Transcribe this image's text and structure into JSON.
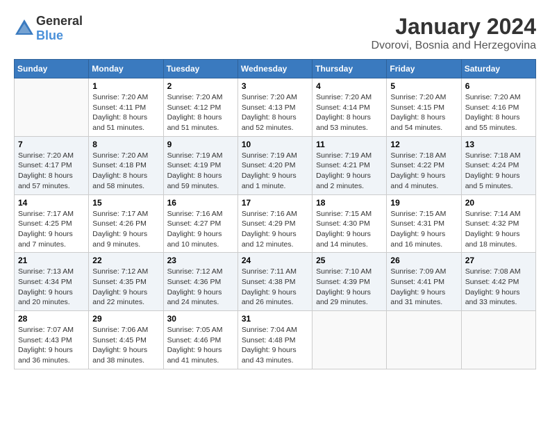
{
  "logo": {
    "general": "General",
    "blue": "Blue"
  },
  "header": {
    "month_year": "January 2024",
    "location": "Dvorovi, Bosnia and Herzegovina"
  },
  "days_of_week": [
    "Sunday",
    "Monday",
    "Tuesday",
    "Wednesday",
    "Thursday",
    "Friday",
    "Saturday"
  ],
  "weeks": [
    [
      {
        "day": "",
        "empty": true
      },
      {
        "day": "1",
        "sunrise": "Sunrise: 7:20 AM",
        "sunset": "Sunset: 4:11 PM",
        "daylight": "Daylight: 8 hours and 51 minutes."
      },
      {
        "day": "2",
        "sunrise": "Sunrise: 7:20 AM",
        "sunset": "Sunset: 4:12 PM",
        "daylight": "Daylight: 8 hours and 51 minutes."
      },
      {
        "day": "3",
        "sunrise": "Sunrise: 7:20 AM",
        "sunset": "Sunset: 4:13 PM",
        "daylight": "Daylight: 8 hours and 52 minutes."
      },
      {
        "day": "4",
        "sunrise": "Sunrise: 7:20 AM",
        "sunset": "Sunset: 4:14 PM",
        "daylight": "Daylight: 8 hours and 53 minutes."
      },
      {
        "day": "5",
        "sunrise": "Sunrise: 7:20 AM",
        "sunset": "Sunset: 4:15 PM",
        "daylight": "Daylight: 8 hours and 54 minutes."
      },
      {
        "day": "6",
        "sunrise": "Sunrise: 7:20 AM",
        "sunset": "Sunset: 4:16 PM",
        "daylight": "Daylight: 8 hours and 55 minutes."
      }
    ],
    [
      {
        "day": "7",
        "sunrise": "Sunrise: 7:20 AM",
        "sunset": "Sunset: 4:17 PM",
        "daylight": "Daylight: 8 hours and 57 minutes."
      },
      {
        "day": "8",
        "sunrise": "Sunrise: 7:20 AM",
        "sunset": "Sunset: 4:18 PM",
        "daylight": "Daylight: 8 hours and 58 minutes."
      },
      {
        "day": "9",
        "sunrise": "Sunrise: 7:19 AM",
        "sunset": "Sunset: 4:19 PM",
        "daylight": "Daylight: 8 hours and 59 minutes."
      },
      {
        "day": "10",
        "sunrise": "Sunrise: 7:19 AM",
        "sunset": "Sunset: 4:20 PM",
        "daylight": "Daylight: 9 hours and 1 minute."
      },
      {
        "day": "11",
        "sunrise": "Sunrise: 7:19 AM",
        "sunset": "Sunset: 4:21 PM",
        "daylight": "Daylight: 9 hours and 2 minutes."
      },
      {
        "day": "12",
        "sunrise": "Sunrise: 7:18 AM",
        "sunset": "Sunset: 4:22 PM",
        "daylight": "Daylight: 9 hours and 4 minutes."
      },
      {
        "day": "13",
        "sunrise": "Sunrise: 7:18 AM",
        "sunset": "Sunset: 4:24 PM",
        "daylight": "Daylight: 9 hours and 5 minutes."
      }
    ],
    [
      {
        "day": "14",
        "sunrise": "Sunrise: 7:17 AM",
        "sunset": "Sunset: 4:25 PM",
        "daylight": "Daylight: 9 hours and 7 minutes."
      },
      {
        "day": "15",
        "sunrise": "Sunrise: 7:17 AM",
        "sunset": "Sunset: 4:26 PM",
        "daylight": "Daylight: 9 hours and 9 minutes."
      },
      {
        "day": "16",
        "sunrise": "Sunrise: 7:16 AM",
        "sunset": "Sunset: 4:27 PM",
        "daylight": "Daylight: 9 hours and 10 minutes."
      },
      {
        "day": "17",
        "sunrise": "Sunrise: 7:16 AM",
        "sunset": "Sunset: 4:29 PM",
        "daylight": "Daylight: 9 hours and 12 minutes."
      },
      {
        "day": "18",
        "sunrise": "Sunrise: 7:15 AM",
        "sunset": "Sunset: 4:30 PM",
        "daylight": "Daylight: 9 hours and 14 minutes."
      },
      {
        "day": "19",
        "sunrise": "Sunrise: 7:15 AM",
        "sunset": "Sunset: 4:31 PM",
        "daylight": "Daylight: 9 hours and 16 minutes."
      },
      {
        "day": "20",
        "sunrise": "Sunrise: 7:14 AM",
        "sunset": "Sunset: 4:32 PM",
        "daylight": "Daylight: 9 hours and 18 minutes."
      }
    ],
    [
      {
        "day": "21",
        "sunrise": "Sunrise: 7:13 AM",
        "sunset": "Sunset: 4:34 PM",
        "daylight": "Daylight: 9 hours and 20 minutes."
      },
      {
        "day": "22",
        "sunrise": "Sunrise: 7:12 AM",
        "sunset": "Sunset: 4:35 PM",
        "daylight": "Daylight: 9 hours and 22 minutes."
      },
      {
        "day": "23",
        "sunrise": "Sunrise: 7:12 AM",
        "sunset": "Sunset: 4:36 PM",
        "daylight": "Daylight: 9 hours and 24 minutes."
      },
      {
        "day": "24",
        "sunrise": "Sunrise: 7:11 AM",
        "sunset": "Sunset: 4:38 PM",
        "daylight": "Daylight: 9 hours and 26 minutes."
      },
      {
        "day": "25",
        "sunrise": "Sunrise: 7:10 AM",
        "sunset": "Sunset: 4:39 PM",
        "daylight": "Daylight: 9 hours and 29 minutes."
      },
      {
        "day": "26",
        "sunrise": "Sunrise: 7:09 AM",
        "sunset": "Sunset: 4:41 PM",
        "daylight": "Daylight: 9 hours and 31 minutes."
      },
      {
        "day": "27",
        "sunrise": "Sunrise: 7:08 AM",
        "sunset": "Sunset: 4:42 PM",
        "daylight": "Daylight: 9 hours and 33 minutes."
      }
    ],
    [
      {
        "day": "28",
        "sunrise": "Sunrise: 7:07 AM",
        "sunset": "Sunset: 4:43 PM",
        "daylight": "Daylight: 9 hours and 36 minutes."
      },
      {
        "day": "29",
        "sunrise": "Sunrise: 7:06 AM",
        "sunset": "Sunset: 4:45 PM",
        "daylight": "Daylight: 9 hours and 38 minutes."
      },
      {
        "day": "30",
        "sunrise": "Sunrise: 7:05 AM",
        "sunset": "Sunset: 4:46 PM",
        "daylight": "Daylight: 9 hours and 41 minutes."
      },
      {
        "day": "31",
        "sunrise": "Sunrise: 7:04 AM",
        "sunset": "Sunset: 4:48 PM",
        "daylight": "Daylight: 9 hours and 43 minutes."
      },
      {
        "day": "",
        "empty": true
      },
      {
        "day": "",
        "empty": true
      },
      {
        "day": "",
        "empty": true
      }
    ]
  ]
}
